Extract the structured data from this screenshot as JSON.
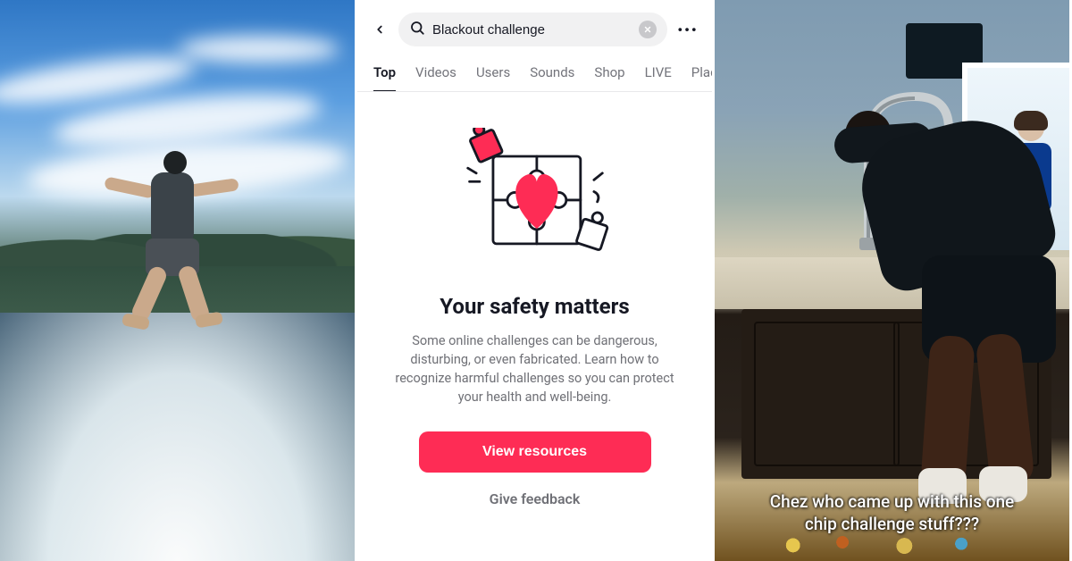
{
  "left_panel": {
    "description": "video-still-lake-jump"
  },
  "center_panel": {
    "search": {
      "value": "Blackout challenge"
    },
    "tabs": [
      "Top",
      "Videos",
      "Users",
      "Sounds",
      "Shop",
      "LIVE",
      "Places"
    ],
    "active_tab_index": 0,
    "safety": {
      "title": "Your safety matters",
      "body": "Some online challenges can be dangerous, disturbing, or even fabricated. Learn how to recognize harmful challenges so you can protect your health and well-being.",
      "primary_button": "View resources",
      "secondary_link": "Give feedback"
    },
    "colors": {
      "accent": "#fe2c55"
    }
  },
  "right_panel": {
    "caption_line1": "Chez who came up with this one",
    "caption_line2": "chip challenge stuff???"
  }
}
